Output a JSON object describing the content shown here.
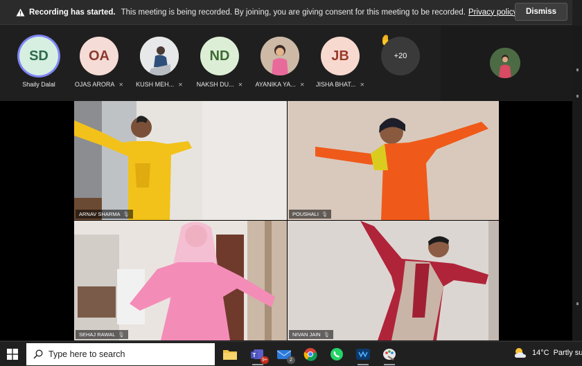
{
  "banner": {
    "title": "Recording has started.",
    "message": "This meeting is being recorded. By joining, you are giving consent for this meeting to be recorded.",
    "link": "Privacy policy",
    "dismiss": "Dismiss"
  },
  "participants": [
    {
      "initials": "SD",
      "name": "Shaily Dalal",
      "color": "#d6efe1",
      "text_color": "#2f6b4b",
      "selected": true
    },
    {
      "initials": "OA",
      "name": "OJAS ARORA",
      "color": "#f6dcd6",
      "text_color": "#8c3a2e"
    },
    {
      "initials": "",
      "name": "KUSH MEH...",
      "photo": true
    },
    {
      "initials": "ND",
      "name": "NAKSH DU...",
      "color": "#dcefd6",
      "text_color": "#3d6b34"
    },
    {
      "initials": "",
      "name": "AYANIKA YA...",
      "photo": true
    },
    {
      "initials": "JB",
      "name": "JISHA BHAT...",
      "color": "#f7d9d0",
      "text_color": "#9a3b2a"
    }
  ],
  "overflow": {
    "count": "+20"
  },
  "videos": [
    {
      "name": "ARNAV SHARMA"
    },
    {
      "name": "POUSHALI"
    },
    {
      "name": "SEHAJ RAWAL"
    },
    {
      "name": "NIVAN JAIN"
    }
  ],
  "taskbar": {
    "search_placeholder": "Type here to search",
    "teams_badge": "9+",
    "mail_badge": "2",
    "temperature": "14°C",
    "condition": "Partly su"
  },
  "colors": {
    "accent": "#7f85f5",
    "banner_bg": "#2b2b2b",
    "taskbar_bg": "#202020"
  }
}
